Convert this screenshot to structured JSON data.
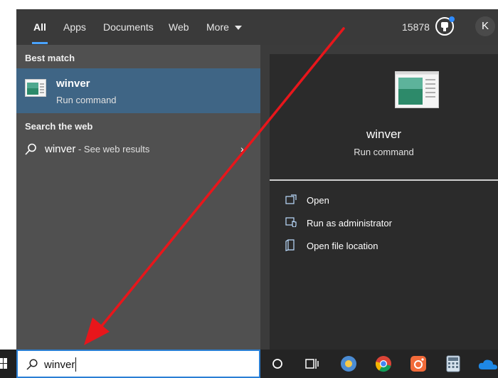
{
  "nav": {
    "tabs": [
      "All",
      "Apps",
      "Documents",
      "Web",
      "More"
    ],
    "points": "15878",
    "avatar_initial": "K"
  },
  "left": {
    "best_match_heading": "Best match",
    "best_match": {
      "title": "winver",
      "subtitle": "Run command"
    },
    "search_web_heading": "Search the web",
    "web_result": {
      "query": "winver",
      "suffix": " - See web results"
    }
  },
  "preview": {
    "title": "winver",
    "subtitle": "Run command",
    "actions": [
      "Open",
      "Run as administrator",
      "Open file location"
    ]
  },
  "search": {
    "value": "winver"
  },
  "taskbar": {
    "icons": [
      "cortana-icon",
      "task-view-icon",
      "weather-icon",
      "chrome-icon",
      "screen-recorder-icon",
      "calculator-icon",
      "onedrive-icon"
    ]
  },
  "colors": {
    "accent": "#4aa3ff",
    "selection": "#3f6585",
    "arrow": "#e8161b"
  }
}
